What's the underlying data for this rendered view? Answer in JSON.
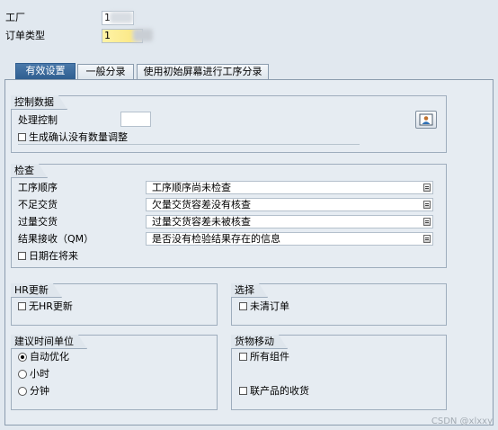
{
  "header": {
    "plant_label": "工厂",
    "plant_value": "1",
    "order_type_label": "订单类型",
    "order_type_value": "1"
  },
  "tabs": [
    {
      "label": "有效设置",
      "active": true
    },
    {
      "label": "一般分录",
      "active": false
    },
    {
      "label": "使用初始屏幕进行工序分录",
      "active": false
    }
  ],
  "control_data": {
    "title": "控制数据",
    "processing_control_label": "处理控制",
    "processing_control_value": "",
    "gen_confirm_label": "生成确认没有数量调整",
    "gen_confirm_checked": false,
    "picture_button_icon": "person-picture-icon"
  },
  "checks": {
    "title": "检查",
    "rows": [
      {
        "label": "工序顺序",
        "value": "工序顺序尚未检查"
      },
      {
        "label": "不足交货",
        "value": "欠量交货容差没有核查"
      },
      {
        "label": "过量交货",
        "value": "过量交货容差未被核查"
      },
      {
        "label": "结果接收（QM）",
        "value": "是否没有检验结果存在的信息"
      }
    ],
    "date_future_label": "日期在将来",
    "date_future_checked": false
  },
  "hr_update": {
    "title": "HR更新",
    "no_hr_label": "无HR更新",
    "no_hr_checked": false
  },
  "selection": {
    "title": "选择",
    "unclear_order_label": "未清订单",
    "unclear_order_checked": false
  },
  "time_unit": {
    "title": "建议时间单位",
    "options": [
      {
        "label": "自动优化",
        "selected": true
      },
      {
        "label": "小时",
        "selected": false
      },
      {
        "label": "分钟",
        "selected": false
      }
    ]
  },
  "goods_movement": {
    "title": "货物移动",
    "all_components_label": "所有组件",
    "all_components_checked": false,
    "coproduct_label": "联产品的收货",
    "coproduct_checked": false
  },
  "watermark": "CSDN @xlxxy",
  "colors": {
    "background": "#e1e8ef",
    "active_tab": "#2f5e90",
    "input_highlight": "#fbe98a"
  }
}
